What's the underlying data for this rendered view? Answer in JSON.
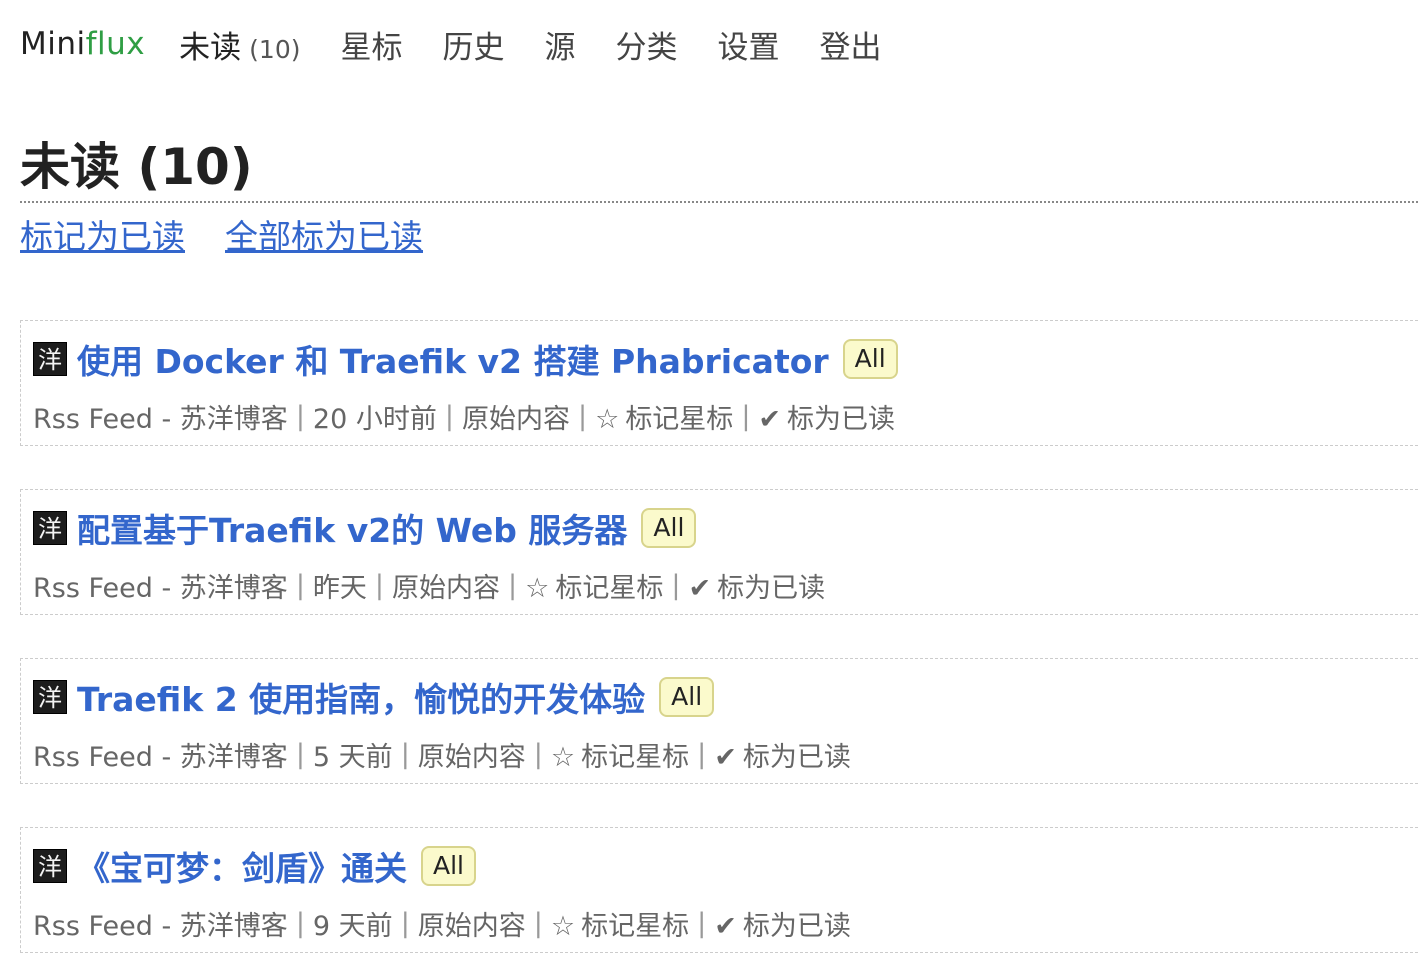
{
  "app": {
    "logo_main": "Mini",
    "logo_accent": "flux",
    "accent_color": "#2f9e44",
    "link_color": "#3366cc"
  },
  "nav": {
    "unread_label": "未读",
    "unread_count": "(10)",
    "starred": "星标",
    "history": "历史",
    "feeds": "源",
    "categories": "分类",
    "settings": "设置",
    "logout": "登出"
  },
  "page": {
    "title": "未读 (10)",
    "actions": {
      "mark_page_read": "标记为已读",
      "mark_all_read": "全部标为已读"
    }
  },
  "entries": [
    {
      "feed_icon_text": "洋",
      "title": "使用 Docker 和 Traefik v2 搭建 Phabricator",
      "category": "All",
      "feed": "Rss Feed - 苏洋博客",
      "time": "20 小时前",
      "original": "原始内容",
      "star_icon": "☆",
      "star_label": "标记星标",
      "check_icon": "✔",
      "read_label": "标为已读"
    },
    {
      "feed_icon_text": "洋",
      "title": "配置基于Traefik v2的 Web 服务器",
      "category": "All",
      "feed": "Rss Feed - 苏洋博客",
      "time": "昨天",
      "original": "原始内容",
      "star_icon": "☆",
      "star_label": "标记星标",
      "check_icon": "✔",
      "read_label": "标为已读"
    },
    {
      "feed_icon_text": "洋",
      "title": "Traefik 2 使用指南，愉悦的开发体验",
      "category": "All",
      "feed": "Rss Feed - 苏洋博客",
      "time": "5 天前",
      "original": "原始内容",
      "star_icon": "☆",
      "star_label": "标记星标",
      "check_icon": "✔",
      "read_label": "标为已读"
    },
    {
      "feed_icon_text": "洋",
      "title": "《宝可梦：剑盾》通关",
      "category": "All",
      "feed": "Rss Feed - 苏洋博客",
      "time": "9 天前",
      "original": "原始内容",
      "star_icon": "☆",
      "star_label": "标记星标",
      "check_icon": "✔",
      "read_label": "标为已读"
    }
  ]
}
